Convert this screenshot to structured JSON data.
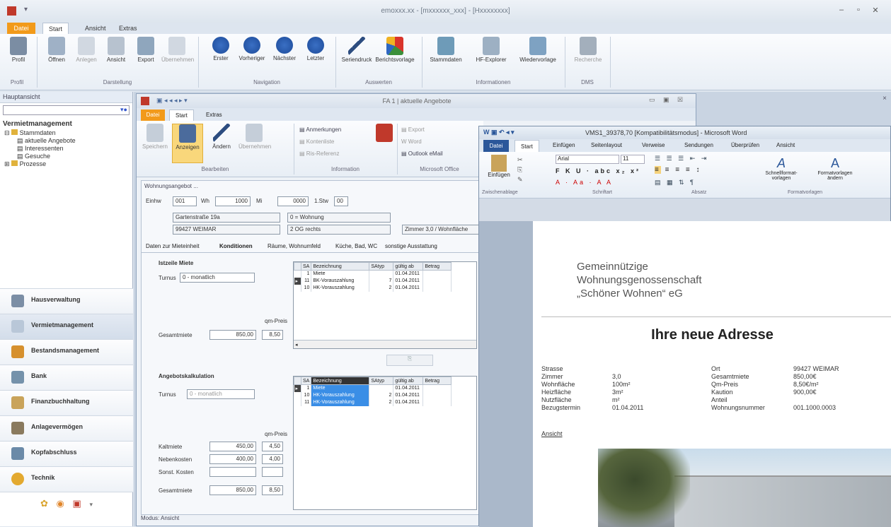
{
  "app": {
    "title": "emoxxx.xx - [mxxxxxx_xxx] - [Hxxxxxxxx]",
    "qa": "▾"
  },
  "main_tabs": [
    "Datei",
    "Start",
    "Ansicht",
    "Extras"
  ],
  "ribbon": {
    "buttons": [
      "Profil",
      "Öffnen",
      "Anlegen",
      "Ansicht",
      "Export",
      "Übernehmen",
      "Erster",
      "Vorheriger",
      "Nächster",
      "Letzter",
      "Seriendruck",
      "Berichtsvorlage",
      "Stammdaten",
      "HF-Explorer",
      "Wiedervorlage",
      "Recherche"
    ],
    "groups": [
      "Profil",
      "Darstellung",
      "Navigation",
      "Auswerten",
      "Informationen",
      "DMS"
    ]
  },
  "nav": {
    "header": "Hauptansicht",
    "title": "Vermietmanagement",
    "tree": {
      "root": "Stammdaten",
      "items": [
        "aktuelle Angebote",
        "Interessenten",
        "Gesuche"
      ],
      "root2": "Prozesse"
    },
    "modules": [
      "Hausverwaltung",
      "Vermietmanagement",
      "Bestandsmanagement",
      "Bank",
      "Finanzbuchhaltung",
      "Anlagevermögen",
      "Kopfabschluss",
      "Technik"
    ]
  },
  "win2": {
    "title": "FA 1 | aktuelle Angebote",
    "tabs": [
      "Datei",
      "Start",
      "Extras"
    ],
    "ribbon_buttons": [
      "Speichern",
      "Anzeigen",
      "Ändern",
      "Übernehmen"
    ],
    "ribbon_small": [
      "Anmerkungen",
      "Kontenliste",
      "Ris-Referenz",
      "Export",
      "Word",
      "Outlook eMail"
    ],
    "ribbon_groups": [
      "Bearbeiten",
      "Information",
      "Microsoft Office"
    ],
    "form_header": "Wohnungsangebot ...",
    "row1": {
      "l1": "Einhw",
      "v1": "001",
      "l2": "Wh",
      "v2": "1000",
      "l3": "Mi",
      "v3": "0000",
      "l4": "1.Stw",
      "v4": "00"
    },
    "addr1": "Gartenstraße 19a",
    "addr2": "99427 WEIMAR",
    "addr3": "0 = Wohnung",
    "addr4": "2 OG rechts",
    "zimmer": "Zimmer 3,0 / Wohnfläche",
    "tabs2": [
      "Daten zur Mieteinheit",
      "Konditionen",
      "Räume, Wohnumfeld",
      "Küche, Bad, WC",
      "sonstige Ausstattung"
    ],
    "miete": {
      "title": "Istzeile Miete",
      "turnus_lbl": "Turnus",
      "turnus": "0 - monatlich",
      "gesamt_lbl": "Gesamtmiete",
      "gesamt": "850,00",
      "qm_lbl": "qm-Preis",
      "qm": "8,50"
    },
    "grid1": {
      "headers": [
        "SA",
        "Bezeichnung",
        "SAtyp",
        "gültig ab",
        "Betrag"
      ],
      "rows": [
        [
          "1",
          "Miete",
          "",
          "01.04.2011",
          ""
        ],
        [
          "11",
          "BK-Vorauszahlung",
          "7",
          "01.04.2011",
          ""
        ],
        [
          "10",
          "HK-Vorauszahlung",
          "2",
          "01.04.2011",
          ""
        ]
      ]
    },
    "kalk": {
      "title": "Angebotskalkulation",
      "turnus_lbl": "Turnus",
      "turnus": "0 - monatlich",
      "qm_lbl": "qm-Preis",
      "rows": [
        [
          "Kaltmiete",
          "450,00",
          "4,50"
        ],
        [
          "Nebenkosten",
          "400,00",
          "4,00"
        ],
        [
          "Sonst. Kosten",
          "",
          ""
        ],
        [
          "Gesamtmiete",
          "850,00",
          "8,50"
        ]
      ]
    },
    "grid2": {
      "headers": [
        "SA",
        "Bezeichnung",
        "SAtyp",
        "gültig ab",
        "Betrag"
      ],
      "rows": [
        [
          "1",
          "Miete",
          "",
          "01.04.2011",
          ""
        ],
        [
          "10",
          "HK-Vorauszahlung",
          "2",
          "01.04.2011",
          ""
        ],
        [
          "11",
          "HK-Vorauszahlung",
          "2",
          "01.04.2011",
          ""
        ]
      ]
    },
    "status": "Modus: Ansicht"
  },
  "word": {
    "title": "VMS1_39378,70 [Kompatibilitätsmodus] - Microsoft Word",
    "tabs": [
      "Datei",
      "Start",
      "Einfügen",
      "Seitenlayout",
      "Verweise",
      "Sendungen",
      "Überprüfen",
      "Ansicht"
    ],
    "font": "Arial",
    "size": "11",
    "groups": [
      "Zwischenablage",
      "Schriftart",
      "Absatz",
      "Formatvorlagen"
    ],
    "paste": "Einfügen",
    "styles": [
      "Schnellformat-vorlagen",
      "Formatvorlagen ändern"
    ],
    "company": [
      "Gemeinnützige",
      "Wohnungsgenossenschaft",
      "„Schöner Wohnen“ eG"
    ],
    "heading": "Ihre neue Adresse",
    "left": [
      [
        "Strasse",
        ""
      ],
      [
        "Zimmer",
        "3,0"
      ],
      [
        "Wohnfläche",
        "100m²"
      ],
      [
        "Heizfläche",
        "3m²"
      ],
      [
        "Nutzfläche",
        "m²"
      ],
      [
        "Bezugstermin",
        "01.04.2011"
      ]
    ],
    "right": [
      [
        "Ort",
        "99427 WEIMAR"
      ],
      [
        "Gesamtmiete",
        "850,00€"
      ],
      [
        "Qm-Preis",
        "8,50€/m²"
      ],
      [
        "Kaution",
        "900,00€"
      ],
      [
        "Anteil",
        ""
      ],
      [
        "Wohnungsnummer",
        "001.1000.0003"
      ]
    ],
    "link": "Ansicht"
  }
}
